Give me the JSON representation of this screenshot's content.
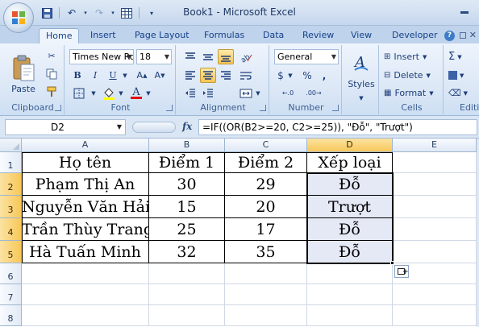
{
  "window": {
    "title": "Book1 - Microsoft Excel"
  },
  "tabs": [
    "Home",
    "Insert",
    "Page Layout",
    "Formulas",
    "Data",
    "Review",
    "View",
    "Developer"
  ],
  "ribbon": {
    "clipboard": {
      "label": "Clipboard",
      "paste_label": "Paste"
    },
    "font": {
      "label": "Font",
      "font_name": "Times New Ro",
      "font_size": "18",
      "bold": "B",
      "italic": "I",
      "underline": "U",
      "font_color_glyph": "A"
    },
    "alignment": {
      "label": "Alignment"
    },
    "number": {
      "label": "Number",
      "format": "General",
      "currency": "$",
      "percent": "%"
    },
    "styles": {
      "label": "Styles"
    },
    "cells": {
      "label": "Cells",
      "insert": "Insert",
      "delete": "Delete",
      "format": "Format"
    },
    "editing": {
      "label": "Editi",
      "sum": "Σ"
    }
  },
  "formula_bar": {
    "name_box": "D2",
    "fx": "fx",
    "formula": "=IF((OR(B2>=20, C2>=25)), \"Đỗ\", \"Trượt\")"
  },
  "columns": [
    "A",
    "B",
    "C",
    "D",
    "E"
  ],
  "rows": [
    "1",
    "2",
    "3",
    "4",
    "5",
    "6",
    "7",
    "8"
  ],
  "table": {
    "headers": [
      "Họ tên",
      "Điểm 1",
      "Điểm 2",
      "Xếp loại"
    ],
    "rows": [
      [
        "Phạm Thị An",
        "30",
        "29",
        "Đỗ"
      ],
      [
        "Nguyễn Văn Hải",
        "15",
        "20",
        "Trượt"
      ],
      [
        "Trần Thùy Trang",
        "25",
        "17",
        "Đỗ"
      ],
      [
        "Hà Tuấn Minh",
        "32",
        "35",
        "Đỗ"
      ]
    ]
  },
  "colors": {
    "accent": "#15428b",
    "selection": "#e5e9f5",
    "selected_header": "#f8c75a"
  }
}
